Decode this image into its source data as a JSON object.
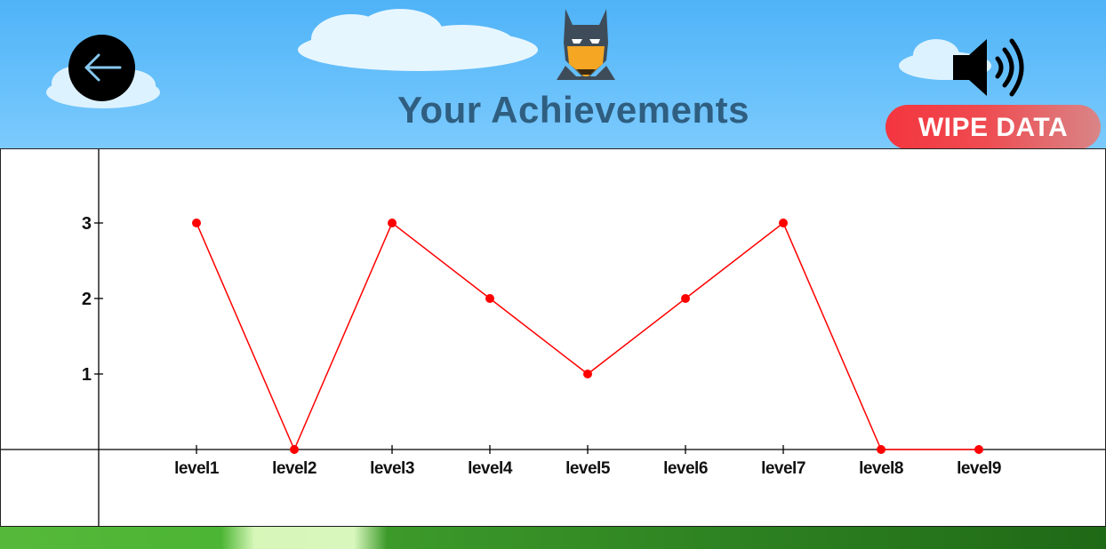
{
  "header": {
    "title": "Your Achievements",
    "wipe_label": "WIPE DATA"
  },
  "icons": {
    "back": "arrow-left-icon",
    "mascot": "batman-mask-icon",
    "sound": "speaker-volume-icon"
  },
  "colors": {
    "sky": "#5cbaf8",
    "title": "#2f5e80",
    "wipe_button": "#f4353f",
    "series": "#ff0000"
  },
  "chart_data": {
    "type": "line",
    "categories": [
      "level1",
      "level2",
      "level3",
      "level4",
      "level5",
      "level6",
      "level7",
      "level8",
      "level9"
    ],
    "series": [
      {
        "values": [
          3,
          0,
          3,
          2,
          1,
          2,
          3,
          0,
          0
        ],
        "color": "#ff0000"
      }
    ],
    "yticks": [
      1,
      2,
      3
    ],
    "ylim": [
      -1,
      4
    ],
    "grid": false,
    "legend": "none"
  }
}
